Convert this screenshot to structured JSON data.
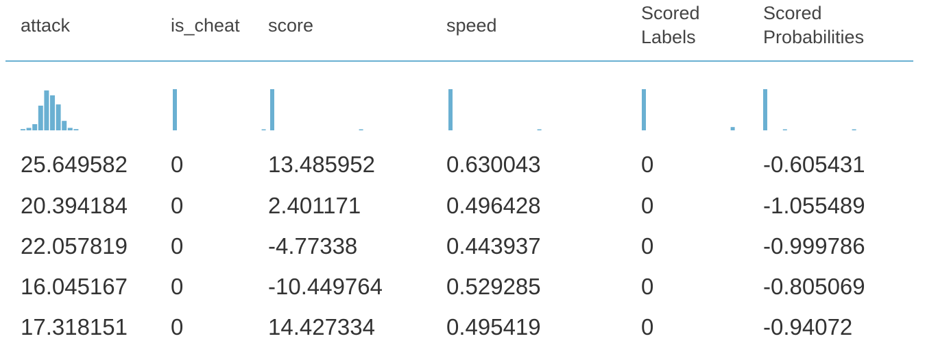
{
  "accent_color": "#6ab0d2",
  "columns": [
    {
      "key": "attack",
      "lines": [
        "attack"
      ]
    },
    {
      "key": "is_cheat",
      "lines": [
        "is_cheat"
      ]
    },
    {
      "key": "score",
      "lines": [
        "score"
      ]
    },
    {
      "key": "speed",
      "lines": [
        "speed"
      ]
    },
    {
      "key": "scored_labels",
      "lines": [
        "Scored",
        "Labels"
      ]
    },
    {
      "key": "scored_probabilities",
      "lines": [
        "Scored",
        "Probabilities"
      ]
    }
  ],
  "histograms": [
    {
      "column": "attack",
      "bins": [
        0.03,
        0.06,
        0.15,
        0.6,
        0.97,
        0.85,
        0.63,
        0.23,
        0.06,
        0.03
      ]
    },
    {
      "column": "is_cheat",
      "bins": [
        1.0,
        0,
        0,
        0,
        0,
        0,
        0,
        0,
        0,
        0.02
      ]
    },
    {
      "column": "score",
      "bins": [
        1.0,
        0,
        0,
        0,
        0,
        0,
        0,
        0,
        0,
        0.02
      ]
    },
    {
      "column": "speed",
      "bins": [
        1.0,
        0,
        0,
        0,
        0,
        0,
        0,
        0,
        0,
        0.02
      ]
    },
    {
      "column": "scored_labels",
      "bins": [
        1.0,
        0,
        0,
        0,
        0,
        0,
        0,
        0,
        0,
        0.08
      ]
    },
    {
      "column": "scored_probabilities",
      "bins": [
        1.0,
        0,
        0.02,
        0,
        0,
        0,
        0,
        0,
        0,
        0.02
      ]
    }
  ],
  "rows": [
    [
      "25.649582",
      "0",
      "13.485952",
      "0.630043",
      "0",
      "-0.605431"
    ],
    [
      "20.394184",
      "0",
      "2.401171",
      "0.496428",
      "0",
      "-1.055489"
    ],
    [
      "22.057819",
      "0",
      "-4.77338",
      "0.443937",
      "0",
      "-0.999786"
    ],
    [
      "16.045167",
      "0",
      "-10.449764",
      "0.529285",
      "0",
      "-0.805069"
    ],
    [
      "17.318151",
      "0",
      "14.427334",
      "0.495419",
      "0",
      "-0.94072"
    ]
  ]
}
